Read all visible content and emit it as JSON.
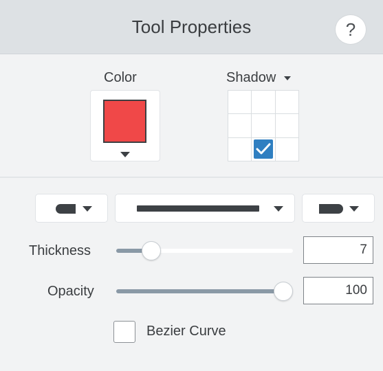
{
  "header": {
    "title": "Tool Properties",
    "help_label": "?"
  },
  "color": {
    "label": "Color",
    "value": "#f04848"
  },
  "shadow": {
    "label": "Shadow",
    "selected_cell": "bottom-center"
  },
  "line_style": {
    "start_cap": "rounded",
    "stroke": "solid",
    "end_cap": "arrow-rounded"
  },
  "thickness": {
    "label": "Thickness",
    "value": "7",
    "fraction": 0.16
  },
  "opacity": {
    "label": "Opacity",
    "value": "100",
    "fraction": 1.0
  },
  "bezier": {
    "label": "Bezier Curve",
    "checked": false
  },
  "colors": {
    "accent": "#2f7fc1",
    "track_fill": "#8a99a6",
    "header_bg": "#dde1e4"
  }
}
